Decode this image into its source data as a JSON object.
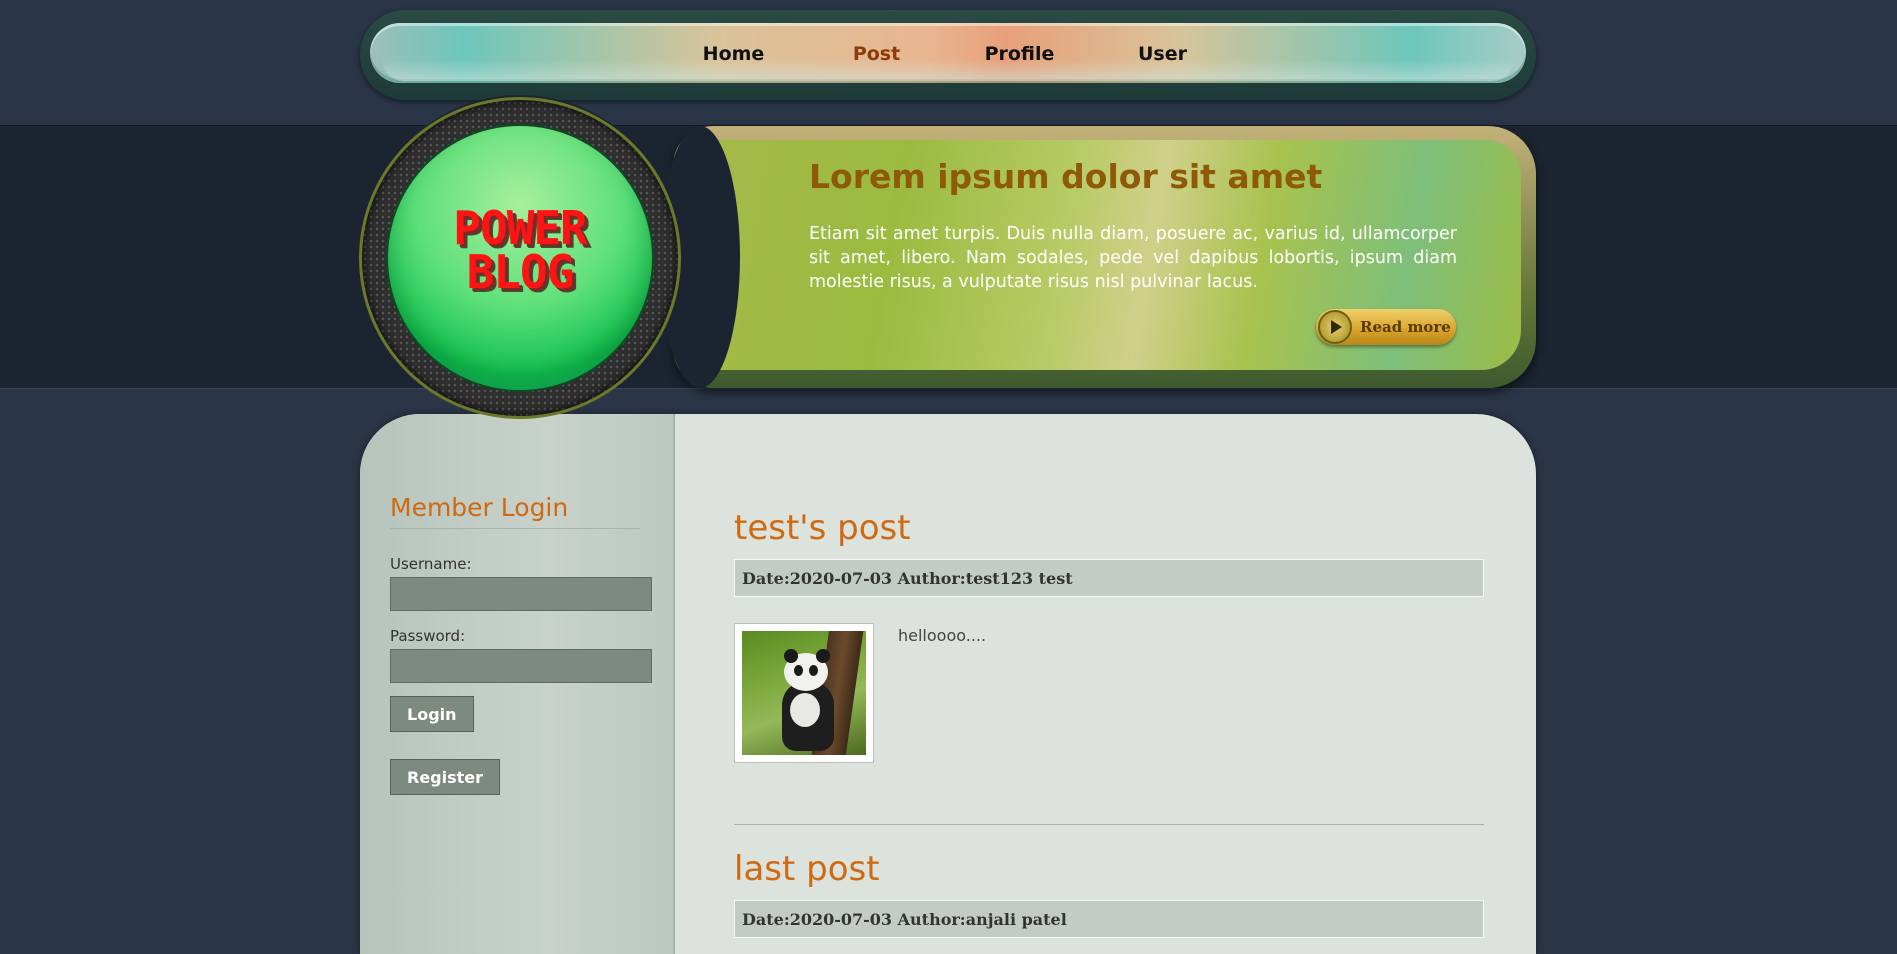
{
  "nav": {
    "items": [
      {
        "label": "Home",
        "active": false
      },
      {
        "label": "Post",
        "active": true
      },
      {
        "label": "Profile",
        "active": false
      },
      {
        "label": "User",
        "active": false
      }
    ]
  },
  "logo": {
    "line1": "POWER",
    "line2": "BLOG"
  },
  "banner": {
    "title": "Lorem ipsum dolor sit amet",
    "text": "Etiam sit amet turpis. Duis nulla diam, posuere ac, varius id, ullamcorper sit amet, libero. Nam sodales, pede vel dapibus lobortis, ipsum diam molestie risus, a vulputate risus nisl pulvinar lacus.",
    "read_more": "Read more"
  },
  "sidebar": {
    "title": "Member Login",
    "username_label": "Username:",
    "username_value": "",
    "password_label": "Password:",
    "password_value": "",
    "login_button": "Login",
    "register_button": "Register"
  },
  "posts": [
    {
      "title": "test's post",
      "meta": "Date:2020-07-03 Author:test123 test",
      "excerpt": "helloooo....",
      "image": "panda-photo"
    },
    {
      "title": "last post",
      "meta": "Date:2020-07-03 Author:anjali patel"
    }
  ],
  "colors": {
    "accent_orange": "#d06a12",
    "nav_active": "#8a3c0a",
    "page_background": "#2a3547",
    "banner_green": "#9bbb40",
    "logo_red": "#ff1414"
  }
}
